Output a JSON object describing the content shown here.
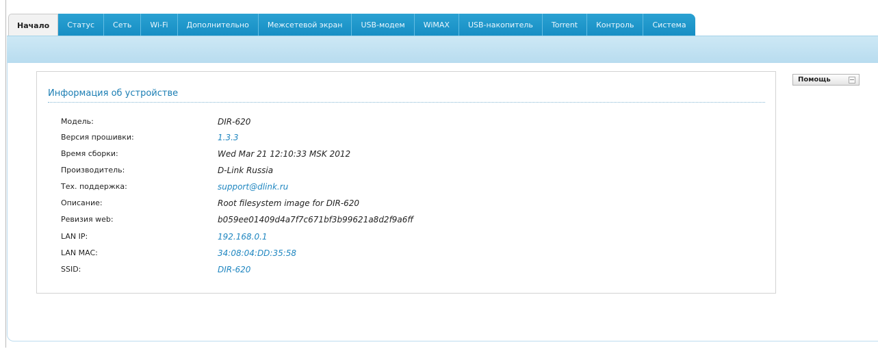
{
  "tabs": [
    {
      "label": "Начало",
      "active": true
    },
    {
      "label": "Статус"
    },
    {
      "label": "Сеть"
    },
    {
      "label": "Wi-Fi"
    },
    {
      "label": "Дополнительно"
    },
    {
      "label": "Межсетевой экран"
    },
    {
      "label": "USB-модем"
    },
    {
      "label": "WiMAX"
    },
    {
      "label": "USB-накопитель"
    },
    {
      "label": "Torrent"
    },
    {
      "label": "Контроль"
    },
    {
      "label": "Система"
    }
  ],
  "device_info": {
    "title": "Информация об устройстве",
    "rows": [
      {
        "label": "Модель:",
        "value": "DIR-620",
        "link": false
      },
      {
        "label": "Версия прошивки:",
        "value": "1.3.3",
        "link": true
      },
      {
        "label": "Время сборки:",
        "value": "Wed Mar 21 12:10:33 MSK 2012",
        "link": false
      },
      {
        "label": "Производитель:",
        "value": "D-Link Russia",
        "link": false
      },
      {
        "label": "Тех. поддержка:",
        "value": "support@dlink.ru",
        "link": true
      },
      {
        "label": "Описание:",
        "value": "Root filesystem image for DIR-620",
        "link": false
      },
      {
        "label": "Ревизия web:",
        "value": "b059ee01409d4a7f7c671bf3b99621a8d2f9a6ff",
        "link": false
      },
      {
        "label": "LAN IP:",
        "value": "192.168.0.1",
        "link": true
      },
      {
        "label": "LAN MAC:",
        "value": "34:08:04:DD:35:58",
        "link": true
      },
      {
        "label": "SSID:",
        "value": "DIR-620",
        "link": true
      }
    ]
  },
  "help": {
    "label": "Помощь"
  },
  "colors": {
    "tab_blue": "#1b94c8",
    "link_blue": "#1f86c0",
    "header_band": "#c4e3f2"
  }
}
